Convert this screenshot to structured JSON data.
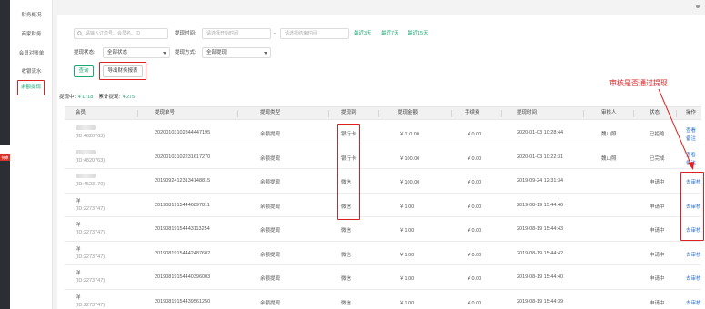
{
  "darkbar": {
    "tag": "待审核"
  },
  "sidebar": {
    "items": [
      {
        "label": "财务概况"
      },
      {
        "label": "商家财务"
      },
      {
        "label": "会员对账单"
      },
      {
        "label": "收银流水"
      },
      {
        "label": "余额提现"
      }
    ]
  },
  "filters": {
    "search_placeholder": "请输入订单号、会员名、ID",
    "time_label": "提现时间:",
    "start_placeholder": "请选择开始时间",
    "dash": "-",
    "end_placeholder": "请选择结束时间",
    "quick": [
      "最近3天",
      "最近7天",
      "最近15天"
    ],
    "status_label": "提现状态:",
    "status_value": "全部状态",
    "method_label": "提现方式:",
    "method_value": "全部提现",
    "query_btn": "查询",
    "export_btn": "导出财务报表"
  },
  "stats": {
    "withdrawing_label": "提现中:",
    "withdrawing_value": "￥1718",
    "total_label": "累计提现:",
    "total_value": "￥275"
  },
  "table": {
    "headers": [
      "会员",
      "提现单号",
      "提现类型",
      "提现到",
      "提现金额",
      "手续费",
      "提现时间",
      "审核人",
      "状态",
      "操作"
    ],
    "rows": [
      {
        "name": "",
        "uid": "(ID:4820763)",
        "order": "20200103102844447195",
        "type": "余额提现",
        "to": "银行卡",
        "amount": "￥110.00",
        "fee": "￥0.00",
        "time": "2020-01-03  10:28:44",
        "auditor": "魏山照",
        "status": "已拒绝",
        "ops": [
          "查看",
          "备注"
        ]
      },
      {
        "name": "",
        "uid": "(ID:4820763)",
        "order": "20200103102231617270",
        "type": "余额提现",
        "to": "银行卡",
        "amount": "￥100.00",
        "fee": "￥0.00",
        "time": "2020-01-03  10:22:31",
        "auditor": "魏山照",
        "status": "已完成",
        "ops": [
          "查看",
          "备注"
        ]
      },
      {
        "name": "",
        "uid": "(ID:4523170)",
        "order": "20190924123134148815",
        "type": "余额提现",
        "to": "微信",
        "amount": "￥100.00",
        "fee": "￥0.00",
        "time": "2019-09-24  12:31:34",
        "auditor": "",
        "status": "申请中",
        "ops": [
          "去审核"
        ]
      },
      {
        "name": "洋",
        "uid": "(ID:2273747)",
        "order": "20190819154446897811",
        "type": "余额提现",
        "to": "微信",
        "amount": "￥1.00",
        "fee": "￥0.00",
        "time": "2019-08-19  15:44:46",
        "auditor": "",
        "status": "申请中",
        "ops": [
          "去审核"
        ]
      },
      {
        "name": "洋",
        "uid": "(ID:2273747)",
        "order": "20190819154443113254",
        "type": "余额提现",
        "to": "微信",
        "amount": "￥1.00",
        "fee": "￥0.00",
        "time": "2019-08-19  15:44:43",
        "auditor": "",
        "status": "申请中",
        "ops": [
          "去审核"
        ]
      },
      {
        "name": "洋",
        "uid": "(ID:2273747)",
        "order": "20190819154442487602",
        "type": "余额提现",
        "to": "微信",
        "amount": "￥1.00",
        "fee": "￥0.00",
        "time": "2019-08-19  15:44:42",
        "auditor": "",
        "status": "申请中",
        "ops": [
          "去审核"
        ]
      },
      {
        "name": "洋",
        "uid": "(ID:2273747)",
        "order": "20190819154440396003",
        "type": "余额提现",
        "to": "微信",
        "amount": "￥1.00",
        "fee": "￥0.00",
        "time": "2019-08-19  15:44:40",
        "auditor": "",
        "status": "申请中",
        "ops": [
          "去审核"
        ]
      },
      {
        "name": "洋",
        "uid": "(ID:2273747)",
        "order": "20190819154439561250",
        "type": "余额提现",
        "to": "微信",
        "amount": "￥1.00",
        "fee": "￥0.00",
        "time": "2019-08-19  15:44:39",
        "auditor": "",
        "status": "申请中",
        "ops": [
          "去审核"
        ]
      }
    ]
  },
  "annotation": {
    "text": "审核是否通过提现"
  },
  "colors": {
    "accent": "#19a971",
    "highlight": "#e02020",
    "link": "#2d6fc7",
    "sidebar_dark": "#2b2e35"
  }
}
